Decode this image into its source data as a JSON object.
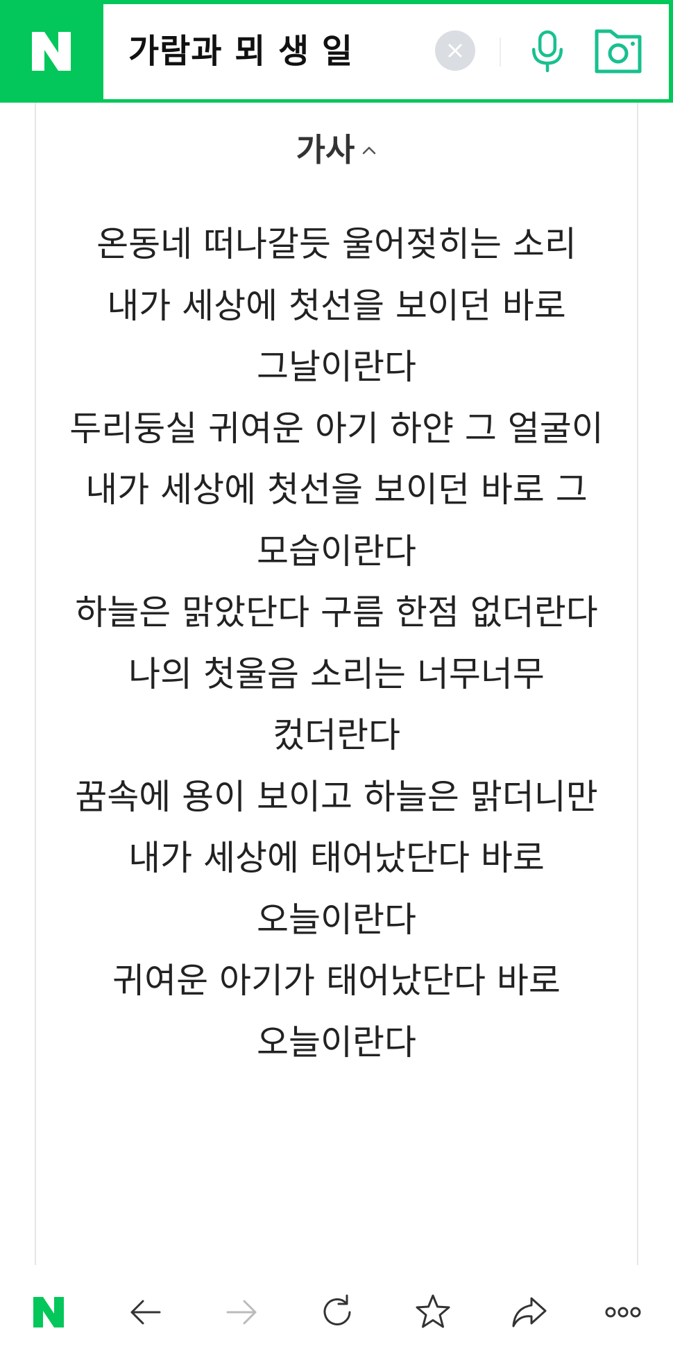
{
  "search": {
    "query": "가람과 뫼 생 일",
    "icons": {
      "logo": "naver-logo-icon",
      "clear": "close-icon",
      "voice": "microphone-icon",
      "lens": "camera-lens-icon"
    }
  },
  "section": {
    "title": "가사",
    "toggle_icon": "chevron-up-icon"
  },
  "lyrics": [
    "온동네 떠나갈듯 울어젖히는 소리",
    "내가 세상에 첫선을 보이던 바로 그날이란다",
    "두리둥실 귀여운 아기 하얀 그 얼굴이",
    "내가 세상에 첫선을 보이던 바로 그 모습이란다",
    "하늘은 맑았단다 구름 한점 없더란다",
    "나의 첫울음 소리는 너무너무 컸더란다",
    "꿈속에 용이 보이고 하늘은 맑더니만",
    "내가 세상에 태어났단다 바로 오늘이란다",
    "귀여운 아기가 태어났단다 바로 오늘이란다"
  ],
  "bottom_nav": {
    "icons": [
      "naver-home-icon",
      "back-arrow-icon",
      "forward-arrow-icon",
      "refresh-icon",
      "bookmark-star-icon",
      "share-icon",
      "more-icon"
    ]
  },
  "colors": {
    "brand_green": "#03c75a",
    "icon_teal": "#19c08f",
    "text_dark": "#222222"
  }
}
